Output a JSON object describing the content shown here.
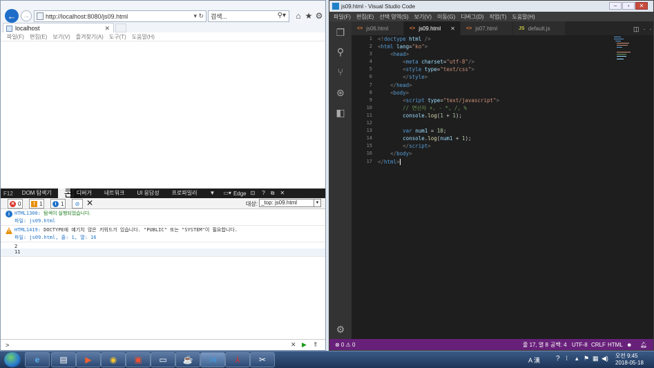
{
  "ie": {
    "address": "http://localhost:8080/js09.html",
    "address_controls": "▾ ↻",
    "search_placeholder": "검색...",
    "tab_title": "localhost",
    "menu": [
      "파일(F)",
      "편집(E)",
      "보기(V)",
      "즐겨찾기(A)",
      "도구(T)",
      "도움말(H)"
    ],
    "devtools": {
      "f12": "F12",
      "tabs": [
        "DOM 탐색기",
        "콘솔",
        "디버거",
        "네트워크",
        "UI 응답성",
        "프로파일러"
      ],
      "active_tab": "콘솔",
      "emulation": "Edge",
      "counts": {
        "errors": "0",
        "warnings": "1",
        "info": "1"
      },
      "target_label": "대상:",
      "target_value": "_top: js09.html",
      "messages": [
        {
          "type": "info",
          "code": "HTML1300:",
          "text": "탐색이 실행되었습니다.",
          "sub": "파일: js09.html"
        },
        {
          "type": "warning",
          "code": "HTML1419:",
          "text": "DOCTYPE에 예기치 않은 키워드가 있습니다. \"PUBLIC\" 또는 \"SYSTEM\"이 필요합니다.",
          "sub": "파일: js09.html, 줄: 1, 열: 16"
        }
      ],
      "outputs": [
        "2",
        "11"
      ],
      "prompt": ">"
    }
  },
  "vscode": {
    "title": "js09.html - Visual Studio Code",
    "menu": [
      "파일(F)",
      "편집(E)",
      "선택 영역(S)",
      "보기(V)",
      "이동(G)",
      "디버그(D)",
      "작업(T)",
      "도움말(H)"
    ],
    "tabs": [
      {
        "label": "js06.html",
        "type": "html",
        "active": false
      },
      {
        "label": "js09.html",
        "type": "html",
        "active": true
      },
      {
        "label": "js07.html",
        "type": "html",
        "active": false
      },
      {
        "label": "default.js",
        "type": "js",
        "active": false
      }
    ],
    "line_numbers": [
      "1",
      "2",
      "3",
      "4",
      "5",
      "6",
      "7",
      "8",
      "9",
      "10",
      "11",
      "12",
      "13",
      "14",
      "15",
      "16",
      "17"
    ],
    "status": {
      "problems": "⊗ 0 ⚠ 0",
      "position": "줄 17, 열 8",
      "spaces": "공백: 4",
      "encoding": "UTF-8",
      "eol": "CRLF",
      "language": "HTML"
    }
  },
  "taskbar": {
    "lang": "A 漢",
    "time": "오전 9:45",
    "date": "2018-05-18"
  },
  "colors": {
    "vs_status": "#68217a",
    "ie_back": "#1e6dc8"
  }
}
